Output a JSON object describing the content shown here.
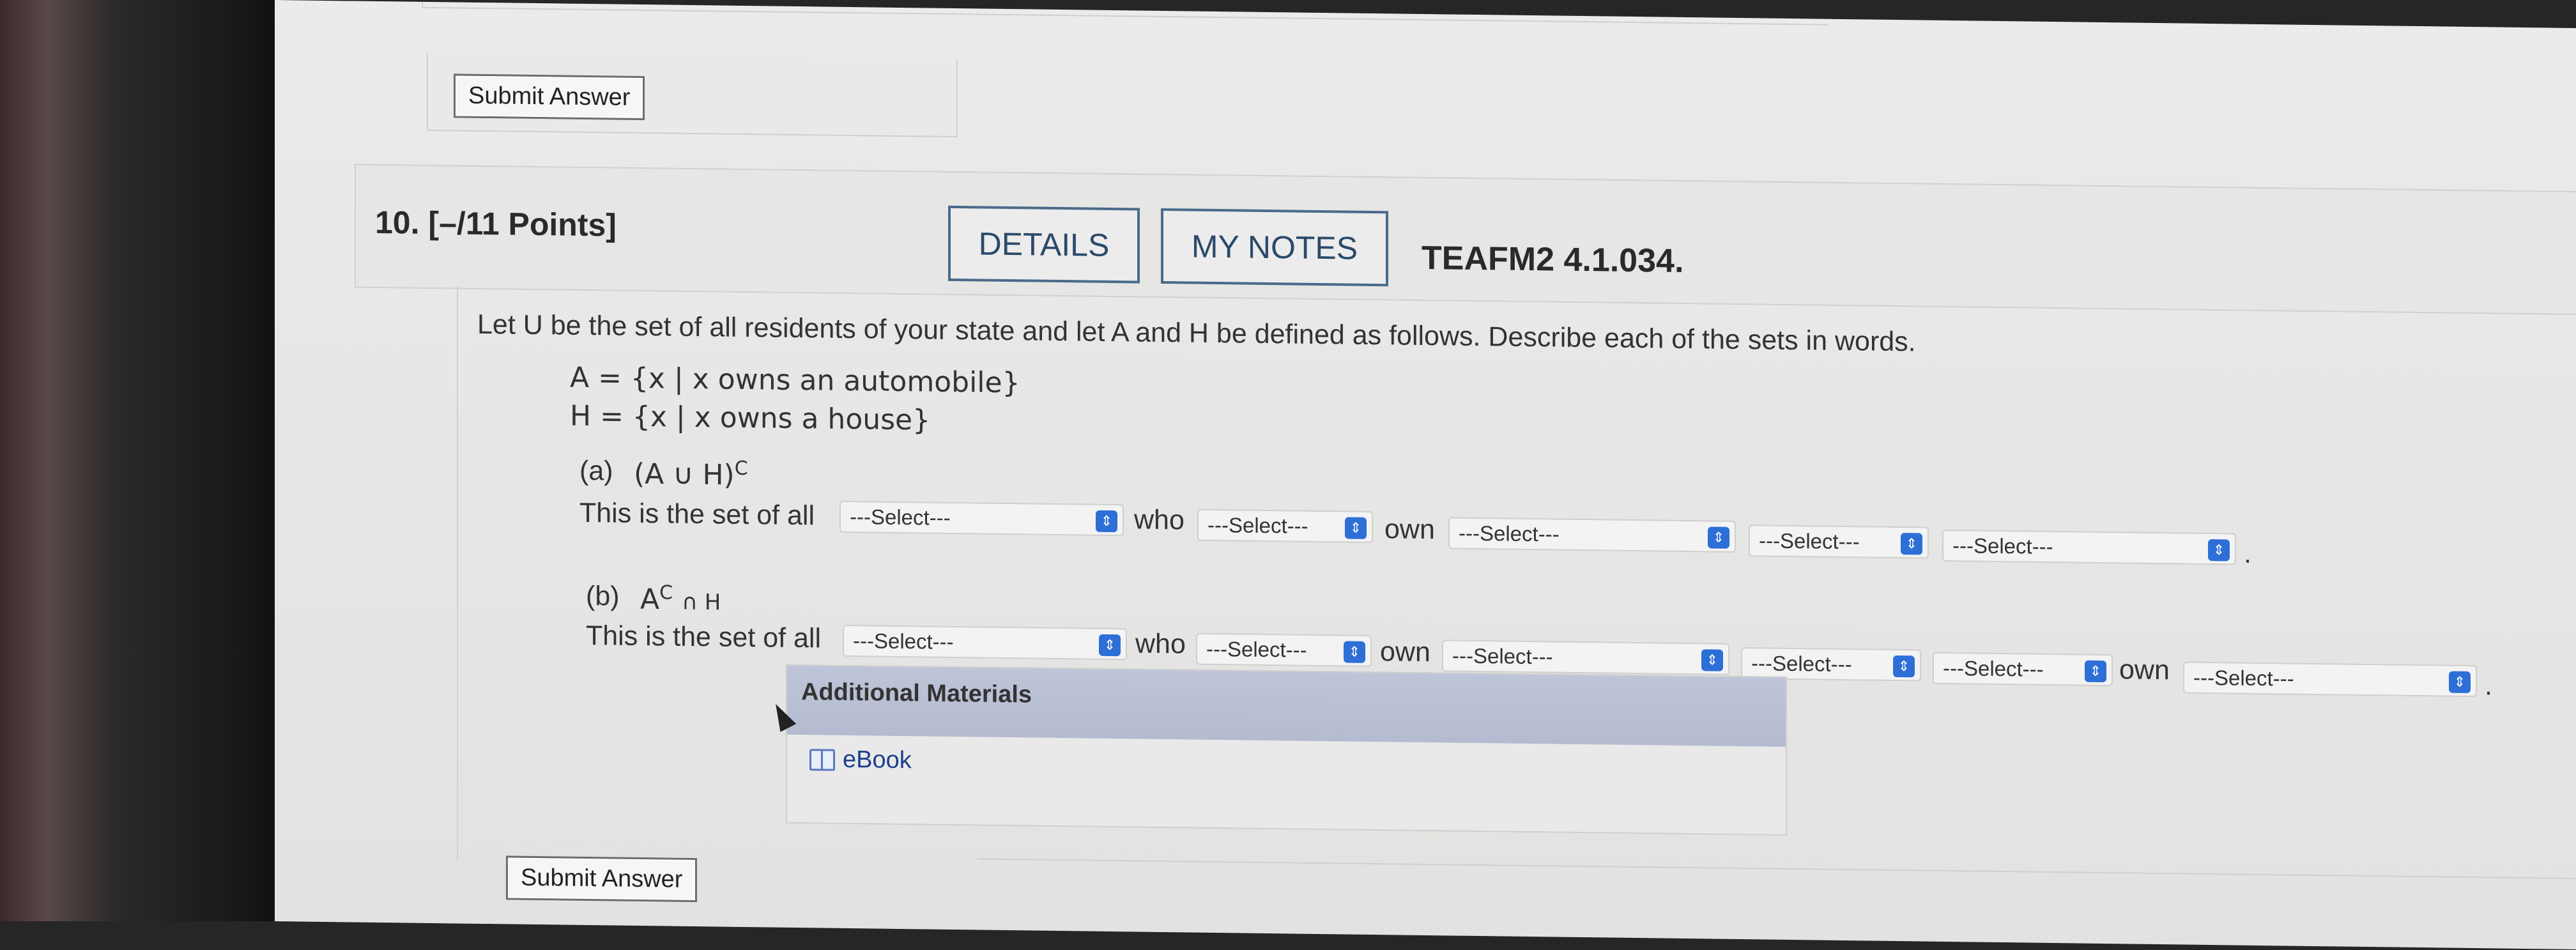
{
  "submit_top": {
    "label": "Submit Answer"
  },
  "question": {
    "number": "10.",
    "points": "[–/11 Points]",
    "details_label": "DETAILS",
    "notes_label": "MY NOTES",
    "code": "TEAFM2 4.1.034."
  },
  "prompt": "Let U be the set of all residents of your state and let A and H be defined as follows. Describe each of the sets in words.",
  "definitions": {
    "a": "A = {x | x owns an automobile}",
    "h": "H = {x | x owns a house}"
  },
  "part_a": {
    "label": "(a)",
    "expr": "(A ∪ H)",
    "sup": "C",
    "lead": "This is the set of all",
    "who": "who",
    "own": "own",
    "period": ".",
    "selects": [
      "---Select---",
      "---Select---",
      "---Select---",
      "---Select---",
      "---Select---"
    ]
  },
  "part_b": {
    "label": "(b)",
    "expr_base": "A",
    "sup": "C",
    "expr_rest": "∩ H",
    "lead": "This is the set of all",
    "who": "who",
    "own1": "own",
    "own2": "own",
    "period": ".",
    "selects": [
      "---Select---",
      "---Select---",
      "---Select---",
      "---Select---",
      "---Select---",
      "---Select---"
    ]
  },
  "additional_materials": {
    "title": "Additional Materials",
    "ebook_label": "eBook",
    "ebook_icon": "book-icon"
  },
  "submit_bottom": {
    "label": "Submit Answer"
  },
  "colors": {
    "select_arrow": "#2d6fd6",
    "link": "#1d3f8a",
    "header_button_border": "#4a6a8a"
  }
}
